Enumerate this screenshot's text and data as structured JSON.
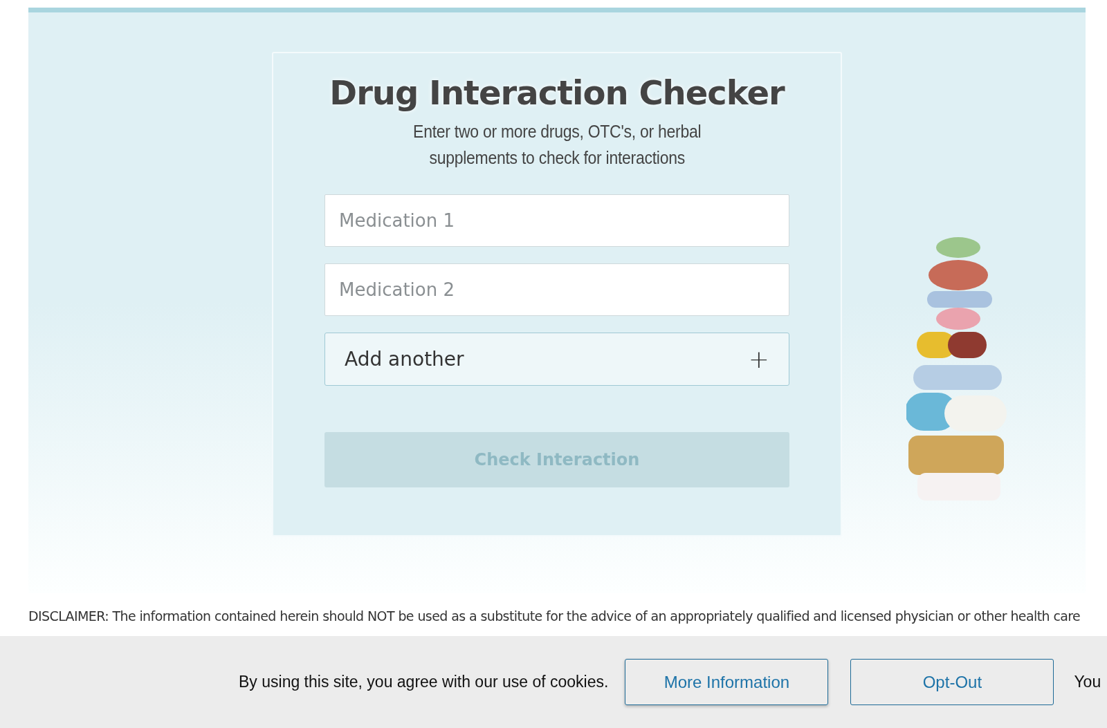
{
  "checker": {
    "title": "Drug Interaction Checker",
    "subtitle_lines": [
      "Enter two or more drugs, OTC's, or herbal",
      "supplements to check for interactions"
    ],
    "fields": [
      {
        "placeholder": "Medication 1"
      },
      {
        "placeholder": "Medication 2"
      }
    ],
    "add_button": {
      "label": "Add another",
      "icon": "+"
    },
    "submit": {
      "label": "Check Interaction",
      "disabled": true
    }
  },
  "side_image": {
    "kind": "picture"
  },
  "disclaimer_lines": [
    "DISCLAIMER: The information contained herein should NOT be used as a substitute for the advice of an appropriately qualified and licensed physician or other health care"
  ],
  "cookie_bar": {
    "message": "By using this site, you agree with our use of cookies.",
    "buttons": [
      "More Information",
      "Opt-Out"
    ],
    "trailing_text": "You"
  }
}
